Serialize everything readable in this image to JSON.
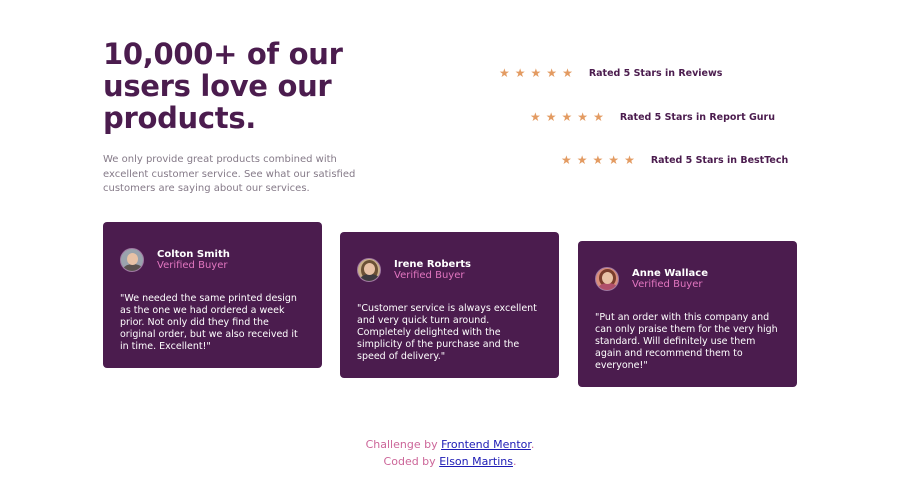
{
  "hero": {
    "title": "10,000+ of our users love our products.",
    "description": "We only provide great products combined with excellent customer service. See what our satisfied customers are saying about our services."
  },
  "ratings": [
    {
      "stars": 5,
      "label": "Rated 5 Stars in Reviews"
    },
    {
      "stars": 5,
      "label": "Rated 5 Stars in Report Guru"
    },
    {
      "stars": 5,
      "label": "Rated 5 Stars in BestTech"
    }
  ],
  "testimonials": [
    {
      "name": "Colton Smith",
      "role": "Verified Buyer",
      "quote": "\"We needed the same printed design as the one we had ordered a week prior. Not only did they find the original order, but we also received it in time. Excellent!\""
    },
    {
      "name": "Irene Roberts",
      "role": "Verified Buyer",
      "quote": "\"Customer service is always excellent and very quick turn around. Completely delighted with the simplicity of the purchase and the speed of delivery.\""
    },
    {
      "name": "Anne Wallace",
      "role": "Verified Buyer",
      "quote": "\"Put an order with this company and can only praise them for the very high standard. Will definitely use them again and recommend them to everyone!\""
    }
  ],
  "footer": {
    "challenge_prefix": "Challenge by",
    "challenge_link": "Frontend Mentor",
    "coded_prefix": "Coded by",
    "coded_link": "Elson Martins",
    "period": "."
  },
  "colors": {
    "primary": "#4b1c4e",
    "accent_pink": "#e276c0",
    "star": "#e39b62",
    "muted_text": "#857a88",
    "link": "#1d1bb5"
  },
  "icons": {
    "star": "star-icon"
  }
}
